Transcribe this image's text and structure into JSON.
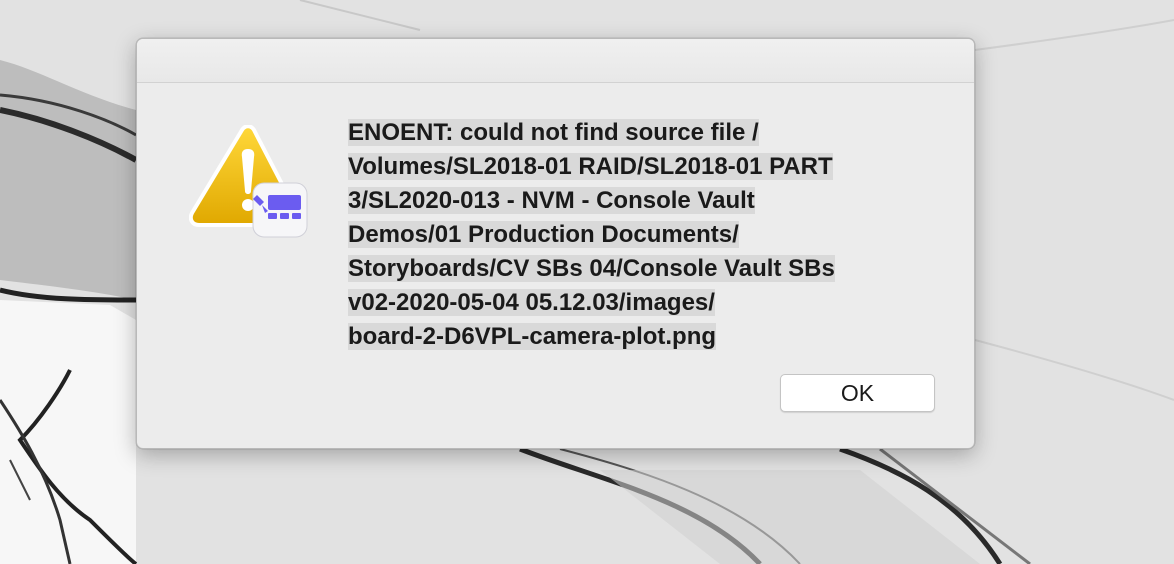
{
  "dialog": {
    "title": "",
    "icon": "warning-app-icon",
    "message_lines": [
      "ENOENT: could not find source file /",
      "Volumes/SL2018-01 RAID/SL2018-01 PART",
      "3/SL2020-013 - NVM - Console Vault",
      "Demos/01 Production Documents/",
      "Storyboards/CV SBs 04/Console Vault SBs",
      "v02-2020-05-04 05.12.03/images/",
      "board-2-D6VPL-camera-plot.png"
    ],
    "ok_label": "OK"
  },
  "colors": {
    "warning_yellow": "#f2c40f",
    "badge_purple": "#6b5cf0",
    "dialog_bg": "#ececec"
  }
}
